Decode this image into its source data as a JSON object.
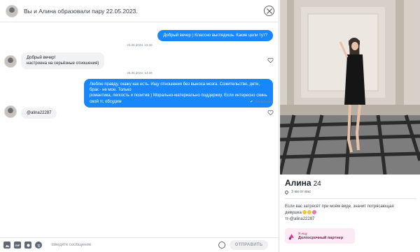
{
  "header": {
    "title": "Вы и Алина образовали пару 22.05.2023."
  },
  "messages": {
    "out1": "Добрый вечер ) Классно выглядишь. Какие цели тут?",
    "ts1": "23.05.2023, 22:33",
    "in1_line1": "Добрый вечер!",
    "in1_line2": "настроена на серьёзные отношения)",
    "ts2": "28.05.2023, 14:26",
    "out2_line1": "Люблю правду, скажу как есть. Ищу отношения без выноса мозга. Сожительство, дети, брак - не мое. Только",
    "out2_line2": "романтика, легкость и позитив ) Морально-материально поддержку. Если интересно скинь свой тг, обсудим",
    "status": "Отправлено",
    "in2": "@alina22287"
  },
  "composer": {
    "placeholder": "Введите сообщение",
    "send_label": "ОТПРАВИТЬ",
    "gif_label": "GIF"
  },
  "profile": {
    "name": "Алина",
    "age": "24",
    "distance": "3 км от вас",
    "bio_line1": "Если вас затрясёт при моём виде, значит потрясающая",
    "bio_line2": "девушка",
    "bio_line3": "тг-@alina22287",
    "goal_caption": "Я ищу",
    "goal_value": "Долгосрочный партнер"
  },
  "colors": {
    "accent": "#1787fb",
    "incoming_bubble": "#f0f2f4",
    "goal_bg": "#fbe9f3"
  },
  "icons": [
    "close-icon",
    "heart-icon",
    "image-icon",
    "gif-icon",
    "sticker-icon",
    "spotify-icon",
    "emoji-icon",
    "location-pin-icon",
    "goal-icon"
  ]
}
